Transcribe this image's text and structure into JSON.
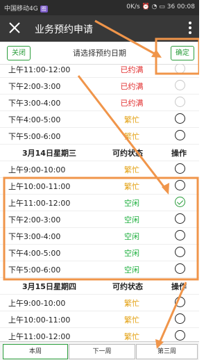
{
  "statusbar": {
    "carrier": "中国移动4G",
    "speed": "0K/s",
    "battery": "36",
    "time": "00:08"
  },
  "appbar": {
    "title": "业务预约申请"
  },
  "dialog": {
    "close_label": "关闭",
    "prompt": "请选择预约日期",
    "confirm_label": "确定"
  },
  "colors": {
    "accent": "#2a9d3b",
    "full": "#e23030",
    "busy": "#e3a010",
    "free": "#20b040",
    "annotation": "#f0954a"
  },
  "day1": {
    "rows": [
      {
        "time": "上午11:00-12:00",
        "status": "已约满",
        "state": "full"
      },
      {
        "time": "下午2:00-3:00",
        "status": "已约满",
        "state": "full"
      },
      {
        "time": "下午3:00-4:00",
        "status": "已约满",
        "state": "full"
      },
      {
        "time": "下午4:00-5:00",
        "status": "繁忙",
        "state": "busy"
      },
      {
        "time": "下午5:00-6:00",
        "status": "繁忙",
        "state": "busy"
      }
    ]
  },
  "day2": {
    "header": {
      "date": "3月14日星期三",
      "status": "可约状态",
      "action": "操作"
    },
    "rows": [
      {
        "time": "上午9:00-10:00",
        "status": "繁忙",
        "state": "busy"
      },
      {
        "time": "上午10:00-11:00",
        "status": "繁忙",
        "state": "busy"
      },
      {
        "time": "上午11:00-12:00",
        "status": "空闲",
        "state": "free",
        "checked": true
      },
      {
        "time": "下午2:00-3:00",
        "status": "空闲",
        "state": "free"
      },
      {
        "time": "下午3:00-4:00",
        "status": "空闲",
        "state": "free"
      },
      {
        "time": "下午4:00-5:00",
        "status": "空闲",
        "state": "free"
      },
      {
        "time": "下午5:00-6:00",
        "status": "空闲",
        "state": "free"
      }
    ]
  },
  "day3": {
    "header": {
      "date": "3月15日星期四",
      "status": "可约状态",
      "action": "操作"
    },
    "rows": [
      {
        "time": "上午9:00-10:00",
        "status": "繁忙",
        "state": "busy"
      },
      {
        "time": "上午10:00-11:00",
        "status": "繁忙",
        "state": "busy"
      },
      {
        "time": "上午11:00-12:00",
        "status": "繁忙",
        "state": "busy"
      }
    ]
  },
  "tabs": [
    {
      "label": "本周",
      "active": true
    },
    {
      "label": "下一周",
      "active": false
    },
    {
      "label": "第三周",
      "active": false
    }
  ]
}
